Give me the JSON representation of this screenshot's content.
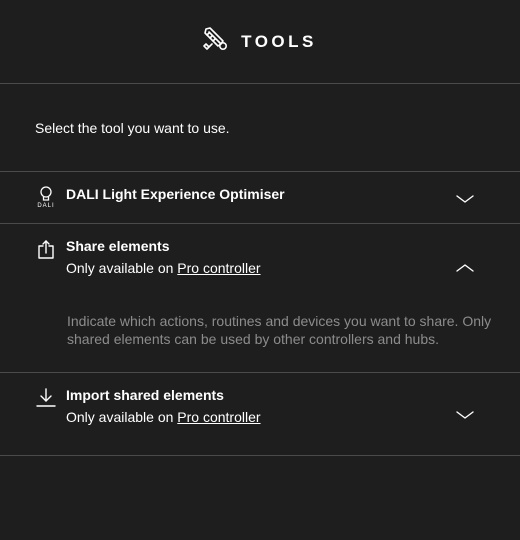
{
  "header": {
    "title": "TOOLS",
    "icon": "tools-icon"
  },
  "intro": {
    "text": "Select the tool you want to use."
  },
  "tools": [
    {
      "title": "DALI Light Experience Optimiser",
      "icon": "dali-bulb-icon",
      "icon_caption": "DALI",
      "expanded": false
    },
    {
      "title": "Share elements",
      "icon": "share-icon",
      "availability_prefix": "Only available on ",
      "availability_link": "Pro controller",
      "description": "Indicate which actions, routines and devices you want to share. Only shared elements can be used by other controllers and hubs.",
      "expanded": true
    },
    {
      "title": "Import shared elements",
      "icon": "import-icon",
      "availability_prefix": "Only available on ",
      "availability_link": "Pro controller",
      "expanded": false
    }
  ],
  "colors": {
    "background": "#1e1e1e",
    "divider": "#4a4a4a",
    "text": "#ffffff",
    "muted_text": "#8c8c8c"
  }
}
